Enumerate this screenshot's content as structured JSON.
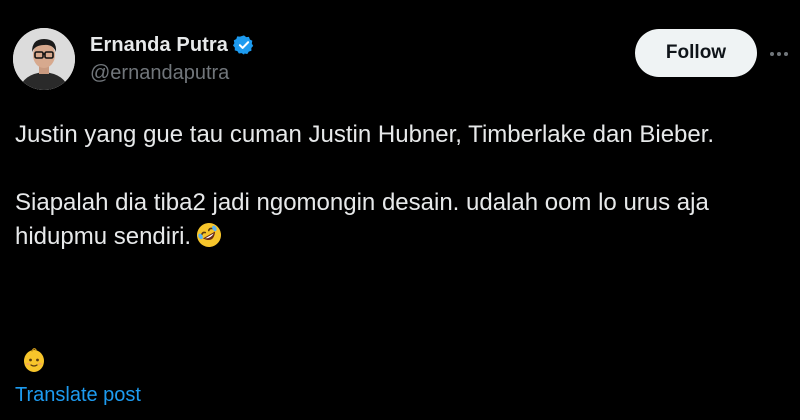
{
  "author": {
    "display_name": "Ernanda Putra",
    "handle": "@ernandaputra",
    "verified": true,
    "avatar_icon": "avatar-photo"
  },
  "header": {
    "follow_label": "Follow",
    "more_icon": "more-options-icon"
  },
  "tweet": {
    "paragraph_1": "Justin yang gue tau cuman Justin Hubner, Timberlake dan Bieber.",
    "paragraph_2": "Siapalah dia tiba2 jadi ngomongin desain.  udalah oom lo urus aja hidupmu sendiri.",
    "paragraph_2_emoji": "rolling-on-floor-laughing-emoji"
  },
  "footer": {
    "reaction_emoji": "baby-emoji",
    "translate_label": "Translate post"
  },
  "colors": {
    "background": "#000000",
    "text": "#e7e9ea",
    "muted": "#71767b",
    "link": "#1d9bf0",
    "verified": "#1d9bf0",
    "follow_bg": "#eff3f4"
  }
}
